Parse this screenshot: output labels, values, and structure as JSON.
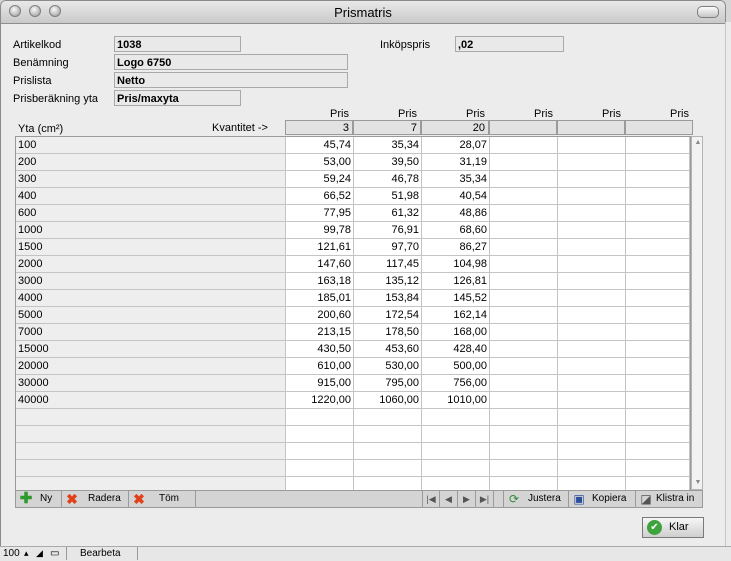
{
  "window": {
    "title": "Prismatris"
  },
  "form": {
    "artikelkod_label": "Artikelkod",
    "artikelkod_value": "1038",
    "benamning_label": "Benämning",
    "benamning_value": "Logo 6750",
    "prislista_label": "Prislista",
    "prislista_value": "Netto",
    "prisberakning_label": "Prisberäkning yta",
    "prisberakning_value": "Pris/maxyta",
    "inkopspris_label": "Inköpspris",
    "inkopspris_value": ",02"
  },
  "matrix": {
    "area_header": "Yta (cm²)",
    "quantity_header": "Kvantitet ->",
    "price_headers": [
      "Pris",
      "Pris",
      "Pris",
      "Pris",
      "Pris",
      "Pris"
    ],
    "quantities": [
      "3",
      "7",
      "20",
      "",
      "",
      ""
    ],
    "rows": [
      {
        "area": "100",
        "prices": [
          "45,74",
          "35,34",
          "28,07",
          "",
          "",
          ""
        ]
      },
      {
        "area": "200",
        "prices": [
          "53,00",
          "39,50",
          "31,19",
          "",
          "",
          ""
        ]
      },
      {
        "area": "300",
        "prices": [
          "59,24",
          "46,78",
          "35,34",
          "",
          "",
          ""
        ]
      },
      {
        "area": "400",
        "prices": [
          "66,52",
          "51,98",
          "40,54",
          "",
          "",
          ""
        ]
      },
      {
        "area": "600",
        "prices": [
          "77,95",
          "61,32",
          "48,86",
          "",
          "",
          ""
        ]
      },
      {
        "area": "1000",
        "prices": [
          "99,78",
          "76,91",
          "68,60",
          "",
          "",
          ""
        ]
      },
      {
        "area": "1500",
        "prices": [
          "121,61",
          "97,70",
          "86,27",
          "",
          "",
          ""
        ]
      },
      {
        "area": "2000",
        "prices": [
          "147,60",
          "117,45",
          "104,98",
          "",
          "",
          ""
        ]
      },
      {
        "area": "3000",
        "prices": [
          "163,18",
          "135,12",
          "126,81",
          "",
          "",
          ""
        ]
      },
      {
        "area": "4000",
        "prices": [
          "185,01",
          "153,84",
          "145,52",
          "",
          "",
          ""
        ]
      },
      {
        "area": "5000",
        "prices": [
          "200,60",
          "172,54",
          "162,14",
          "",
          "",
          ""
        ]
      },
      {
        "area": "7000",
        "prices": [
          "213,15",
          "178,50",
          "168,00",
          "",
          "",
          ""
        ]
      },
      {
        "area": "15000",
        "prices": [
          "430,50",
          "453,60",
          "428,40",
          "",
          "",
          ""
        ]
      },
      {
        "area": "20000",
        "prices": [
          "610,00",
          "530,00",
          "500,00",
          "",
          "",
          ""
        ]
      },
      {
        "area": "30000",
        "prices": [
          "915,00",
          "795,00",
          "756,00",
          "",
          "",
          ""
        ]
      },
      {
        "area": "40000",
        "prices": [
          "1220,00",
          "1060,00",
          "1010,00",
          "",
          "",
          ""
        ]
      },
      {
        "area": "",
        "prices": [
          "",
          "",
          "",
          "",
          "",
          ""
        ]
      },
      {
        "area": "",
        "prices": [
          "",
          "",
          "",
          "",
          "",
          ""
        ]
      },
      {
        "area": "",
        "prices": [
          "",
          "",
          "",
          "",
          "",
          ""
        ]
      },
      {
        "area": "",
        "prices": [
          "",
          "",
          "",
          "",
          "",
          ""
        ]
      },
      {
        "area": "",
        "prices": [
          "",
          "",
          "",
          "",
          "",
          ""
        ]
      }
    ]
  },
  "toolbar": {
    "new_label": "Ny",
    "delete_label": "Radera",
    "clear_label": "Töm",
    "adjust_label": "Justera",
    "copy_label": "Kopiera",
    "paste_label": "Klistra in"
  },
  "buttons": {
    "ok_label": "Klar"
  },
  "statusbar": {
    "zoom": "100",
    "mode": "Bearbeta"
  },
  "colors": {
    "add_icon": "#2e9a2e",
    "delete_icon": "#e0401a",
    "ok_icon": "#3da33d"
  }
}
